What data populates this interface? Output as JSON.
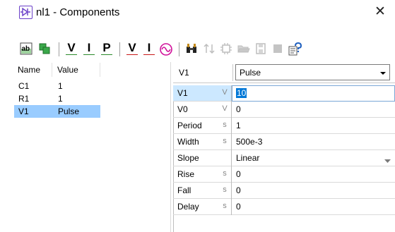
{
  "window": {
    "title": "nl1 - Components",
    "close_glyph": "✕"
  },
  "toolbar": {
    "buttons": [
      {
        "icon": "ab-rename-icon"
      },
      {
        "icon": "green-components-icon"
      },
      {
        "label": "V",
        "icon": "voltage-probe-icon"
      },
      {
        "label": "I",
        "icon": "current-probe-icon"
      },
      {
        "label": "P",
        "icon": "power-probe-icon"
      },
      {
        "label": "V",
        "icon": "voltage-source-icon"
      },
      {
        "label": "I",
        "icon": "current-source-icon"
      },
      {
        "icon": "sine-source-icon"
      },
      {
        "icon": "binoculars-icon"
      },
      {
        "icon": "sort-icon"
      },
      {
        "icon": "chip-icon"
      },
      {
        "icon": "folder-open-icon"
      },
      {
        "icon": "save-icon"
      },
      {
        "icon": "stop-icon"
      },
      {
        "icon": "help-icon"
      }
    ]
  },
  "component_list": {
    "headers": {
      "name": "Name",
      "value": "Value"
    },
    "rows": [
      {
        "name": "C1",
        "value": "1"
      },
      {
        "name": "R1",
        "value": "1"
      },
      {
        "name": "V1",
        "value": "Pulse",
        "selected": true
      }
    ]
  },
  "properties": {
    "component_name": "V1",
    "type_select": {
      "value": "Pulse"
    },
    "rows": [
      {
        "name": "V1",
        "unit": "V",
        "value": "10",
        "selected": true
      },
      {
        "name": "V0",
        "unit": "V",
        "value": "0"
      },
      {
        "name": "Period",
        "unit": "s",
        "value": "1"
      },
      {
        "name": "Width",
        "unit": "s",
        "value": "500e-3"
      },
      {
        "name": "Slope",
        "unit": "",
        "value": "Linear",
        "dropdown": true
      },
      {
        "name": "Rise",
        "unit": "s",
        "value": "0"
      },
      {
        "name": "Fall",
        "unit": "s",
        "value": "0"
      },
      {
        "name": "Delay",
        "unit": "s",
        "value": "0"
      }
    ]
  },
  "colors": {
    "selection": "#99ccff",
    "selected_row": "#cce8ff",
    "value_highlight": "#0078d7",
    "probe_green": "#2a8a2a",
    "source_red": "#c81919"
  }
}
